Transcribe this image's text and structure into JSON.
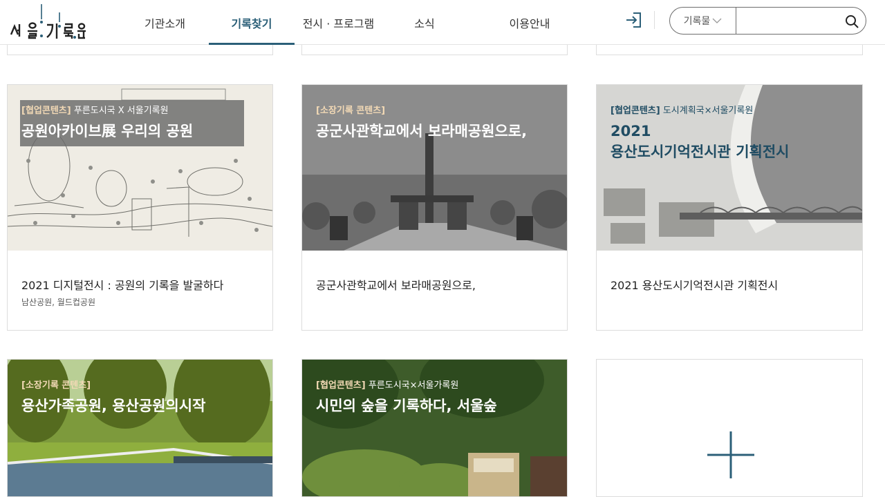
{
  "header": {
    "logo_text": "서울기록원",
    "nav": [
      "기관소개",
      "기록찾기",
      "전시 · 프로그램",
      "소식",
      "이용안내"
    ],
    "active_nav": 1,
    "search": {
      "select_label": "기록물",
      "placeholder": ""
    }
  },
  "cards": [
    {
      "tag_bracket": "[협업콘텐츠]",
      "tag_text": " 푸른도시국 X 서울기록원",
      "overlay_title": "공원아카이브展 우리의 공원",
      "title": "2021 디지털전시 : 공원의 기록을 발굴하다",
      "subtitle": "남산공원, 월드컵공원"
    },
    {
      "tag_bracket": "[소장기록 콘텐츠]",
      "tag_text": "",
      "overlay_title": "공군사관학교에서 보라매공원으로,",
      "title": "공군사관학교에서 보라매공원으로,",
      "subtitle": ""
    },
    {
      "tag_bracket": "[협업콘텐츠]",
      "tag_text": " 도시계획국×서울기록원",
      "overlay_title_1": "2021",
      "overlay_title_2": "용산도시기억전시관 기획전시",
      "title": "2021 용산도시기억전시관 기획전시",
      "subtitle": ""
    },
    {
      "tag_bracket": "[소장기록 콘텐츠]",
      "tag_text": "",
      "overlay_title": "용산가족공원, 용산공원의시작"
    },
    {
      "tag_bracket": "[협업콘텐츠]",
      "tag_text": " 푸른도시국×서울가록원",
      "overlay_title": "시민의 숲을 기록하다, 서울숲"
    }
  ],
  "colors": {
    "accent": "#2b5f78",
    "border": "#dcdcdc"
  }
}
